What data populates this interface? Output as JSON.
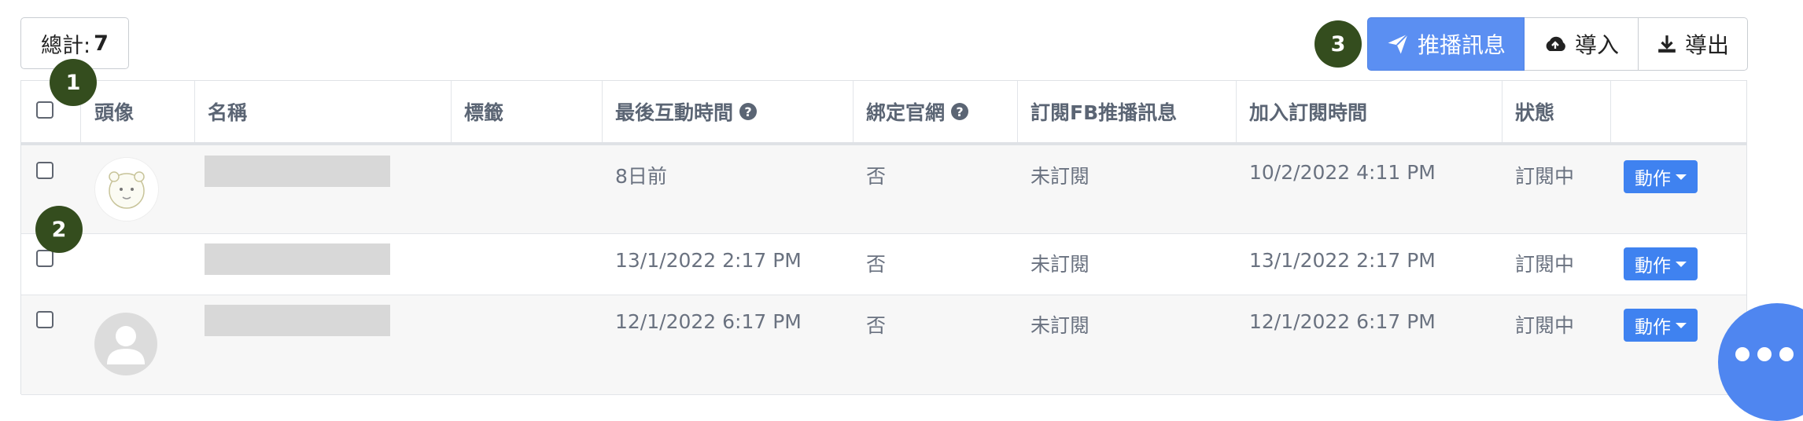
{
  "total": {
    "label": "總計:",
    "count": "7"
  },
  "toolbar": {
    "push_label": "推播訊息",
    "import_label": "導入",
    "export_label": "導出"
  },
  "badges": [
    "1",
    "2",
    "3"
  ],
  "table": {
    "headers": {
      "avatar": "頭像",
      "name": "名稱",
      "tags": "標籤",
      "last_interaction": "最後互動時間",
      "bind_site": "綁定官網",
      "fb_subscribe": "訂閱FB推播訊息",
      "join_time": "加入訂閱時間",
      "status": "狀態"
    },
    "rows": [
      {
        "last_interaction": "8日前",
        "bind_site": "否",
        "fb_subscribe": "未訂閱",
        "join_time": "10/2/2022 4:11 PM",
        "status": "訂閱中",
        "action": "動作"
      },
      {
        "last_interaction": "13/1/2022 2:17 PM",
        "bind_site": "否",
        "fb_subscribe": "未訂閱",
        "join_time": "13/1/2022 2:17 PM",
        "status": "訂閱中",
        "action": "動作"
      },
      {
        "last_interaction": "12/1/2022 6:17 PM",
        "bind_site": "否",
        "fb_subscribe": "未訂閱",
        "join_time": "12/1/2022 6:17 PM",
        "status": "訂閱中",
        "action": "動作"
      }
    ]
  },
  "colors": {
    "primary": "#5b8ff2",
    "action": "#3f82f0",
    "badge": "#344d1e"
  }
}
